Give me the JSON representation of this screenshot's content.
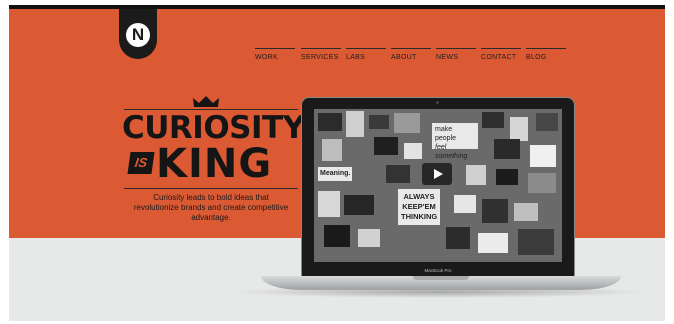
{
  "logo": {
    "letter": "N"
  },
  "nav": {
    "items": [
      "WORK",
      "SERVICES",
      "LABS",
      "ABOUT",
      "NEWS",
      "CONTACT",
      "BLOG"
    ]
  },
  "hero": {
    "headline_line1": "CURIOSITY",
    "headline_is": "IS",
    "headline_line2": "KING",
    "tagline": "Curiosity leads to bold ideas that revolutionize brands and create competitive advantage."
  },
  "laptop": {
    "brand": "MacBook Pro",
    "screen_notes": {
      "note1": "make people",
      "note2": "feel something",
      "note3": "ALWAYS",
      "note4": "KEEP'EM",
      "note5": "THINKING",
      "note6": "Meaning."
    }
  },
  "colors": {
    "accent": "#dc5a33",
    "dark": "#151515",
    "page_bg": "#e7e8e8"
  }
}
